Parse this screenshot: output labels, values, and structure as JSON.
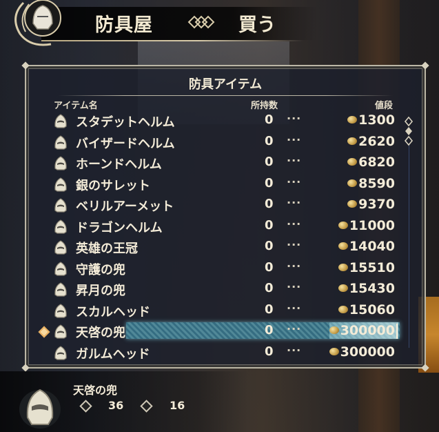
{
  "header": {
    "shop": "防具屋",
    "mode": "買う"
  },
  "panel": {
    "title": "防具アイテム",
    "col_item": "アイテム名",
    "col_owned": "所持数",
    "col_price": "値段"
  },
  "items": [
    {
      "name": "スタデットヘルム",
      "owned": "0",
      "dots": "···",
      "price": "1300"
    },
    {
      "name": "バイザードヘルム",
      "owned": "0",
      "dots": "···",
      "price": "2620"
    },
    {
      "name": "ホーンドヘルム",
      "owned": "0",
      "dots": "···",
      "price": "6820"
    },
    {
      "name": "銀のサレット",
      "owned": "0",
      "dots": "···",
      "price": "8590"
    },
    {
      "name": "ベリルアーメット",
      "owned": "0",
      "dots": "···",
      "price": "9370"
    },
    {
      "name": "ドラゴンヘルム",
      "owned": "0",
      "dots": "···",
      "price": "11000"
    },
    {
      "name": "英雄の王冠",
      "owned": "0",
      "dots": "···",
      "price": "14040"
    },
    {
      "name": "守護の兜",
      "owned": "0",
      "dots": "···",
      "price": "15510"
    },
    {
      "name": "昇月の兜",
      "owned": "0",
      "dots": "···",
      "price": "15430"
    },
    {
      "name": "スカルヘッド",
      "owned": "0",
      "dots": "···",
      "price": "15060"
    },
    {
      "name": "天啓の兜",
      "owned": "0",
      "dots": "···",
      "price": "300000"
    },
    {
      "name": "ガルムヘッド",
      "owned": "0",
      "dots": "···",
      "price": "300000"
    }
  ],
  "selected_index": 10,
  "detail": {
    "name": "天啓の兜",
    "stat1": "36",
    "stat2": "16"
  },
  "colors": {
    "text": "#f4ecd8",
    "highlight": "#78dcf0",
    "coin": "#c29a45"
  }
}
